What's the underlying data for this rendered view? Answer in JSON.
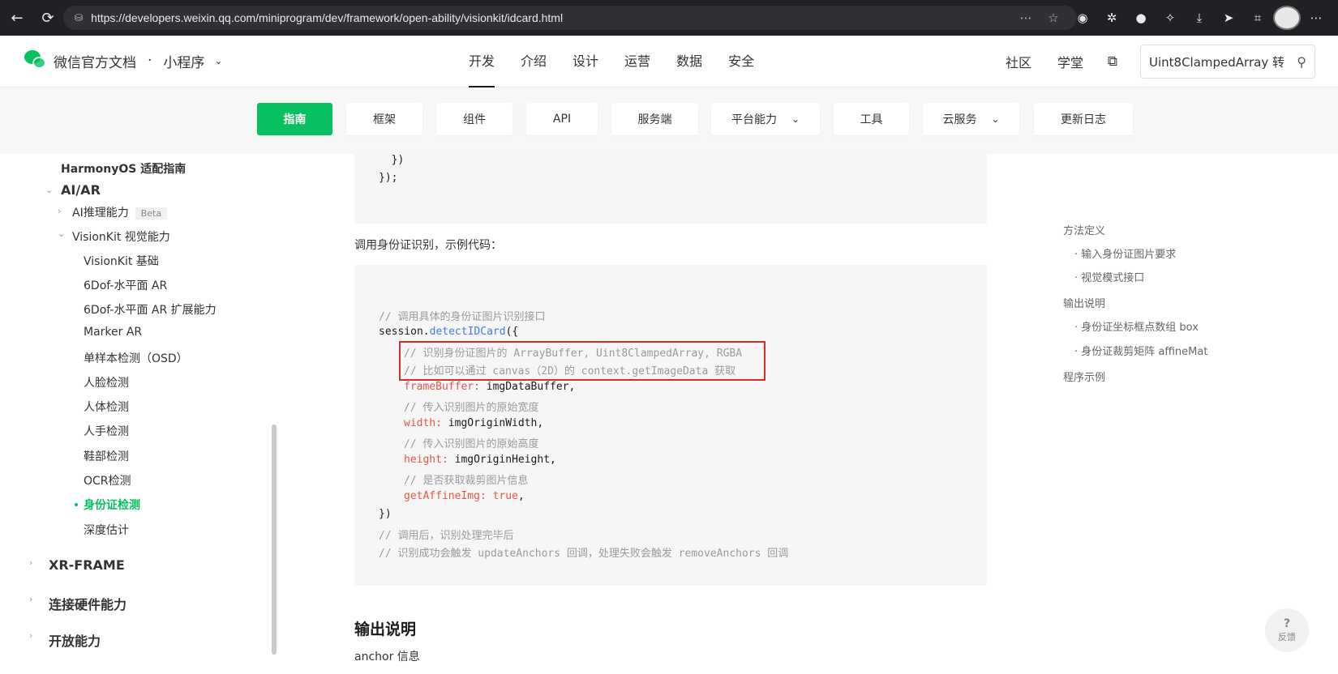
{
  "browser": {
    "url": "https://developers.weixin.qq.com/miniprogram/dev/framework/open-ability/visionkit/idcard.html",
    "back_icon": "arrow-left",
    "reload_icon": "reload"
  },
  "header": {
    "brand": "微信官方文档",
    "separator": "·",
    "product": "小程序",
    "nav": [
      "开发",
      "介绍",
      "设计",
      "运营",
      "数据",
      "安全"
    ],
    "active_nav": "开发",
    "right_links": [
      "社区",
      "学堂"
    ],
    "search_value": "Uint8ClampedArray 转"
  },
  "subnav": {
    "items": [
      "指南",
      "框架",
      "组件",
      "API",
      "服务端",
      "平台能力",
      "工具",
      "云服务",
      "更新日志"
    ],
    "active": "指南"
  },
  "sidebar": {
    "harmony": "HarmonyOS 适配指南",
    "aiar": "AI/AR",
    "ai_infer": "AI推理能力",
    "beta": "Beta",
    "visionkit": "VisionKit 视觉能力",
    "items": [
      "VisionKit 基础",
      "6Dof-水平面 AR",
      "6Dof-水平面 AR 扩展能力",
      "Marker AR",
      "单样本检测（OSD）",
      "人脸检测",
      "人体检测",
      "人手检测",
      "鞋部检测",
      "OCR检测",
      "身份证检测",
      "深度估计"
    ],
    "active_item": "身份证检测",
    "sections": [
      "XR-FRAME",
      "连接硬件能力",
      "开放能力"
    ]
  },
  "content": {
    "code_top_line1": "  })",
    "code_top_line2": "});",
    "intro_text": "调用身份证识别，示例代码：",
    "code": {
      "l1": "// 调用具体的身份证图片识别接口",
      "l2_obj": "session.",
      "l2_fn": "detectIDCard",
      "l2_end": "({",
      "l3": "// 识别身份证图片的 ArrayBuffer, Uint8ClampedArray, RGBA",
      "l4": "// 比如可以通过 canvas（2D）的 context.getImageData 获取",
      "l5_key": "frameBuffer:",
      "l5_val": " imgDataBuffer,",
      "l6": "// 传入识别图片的原始宽度",
      "l7_key": "width:",
      "l7_val": " imgOriginWidth,",
      "l8": "// 传入识别图片的原始高度",
      "l9_key": "height:",
      "l9_val": " imgOriginHeight,",
      "l10": "// 是否获取裁剪图片信息",
      "l11_key": "getAffineImg:",
      "l11_bool": " true",
      "l11_end": ",",
      "l12": "})",
      "l13": "// 调用后，识别处理完毕后",
      "l14": "// 识别成功会触发 updateAnchors 回调，处理失败会触发 removeAnchors 回调"
    },
    "section_title": "输出说明",
    "anchor_text": "anchor 信息"
  },
  "toc": {
    "items": [
      "方法定义",
      "· 输入身份证图片要求",
      "· 视觉模式接口",
      "输出说明",
      "· 身份证坐标框点数组 box",
      "· 身份证裁剪矩阵 affineMat",
      "程序示例"
    ]
  },
  "feedback": {
    "icon": "?",
    "label": "反馈"
  },
  "colors": {
    "accent": "#07c160",
    "highlight_border": "#d32f2f"
  }
}
